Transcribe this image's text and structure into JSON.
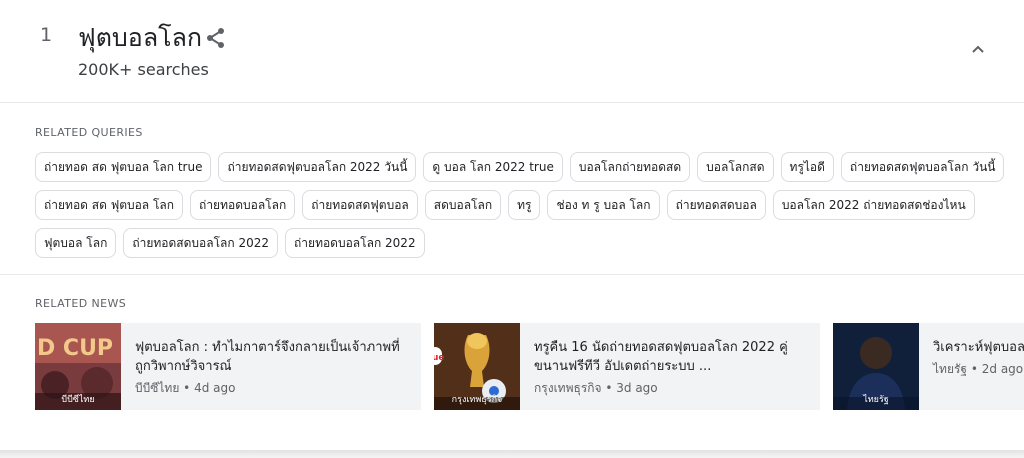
{
  "trend": {
    "rank": "1",
    "title": "ฟุตบอลโลก",
    "searches": "200K+ searches"
  },
  "related_queries": {
    "label": "RELATED QUERIES",
    "rows": [
      [
        "ถ่ายทอด สด ฟุตบอล โลก true",
        "ถ่ายทอดสดฟุตบอลโลก 2022 วันนี้",
        "ดู บอล โลก 2022 true",
        "บอลโลกถ่ายทอดสด",
        "บอลโลกสด",
        "ทรูไอดี",
        "ถ่ายทอดสดฟุตบอลโลก วันนี้"
      ],
      [
        "ถ่ายทอด สด ฟุตบอล โลก",
        "ถ่ายทอดบอลโลก",
        "ถ่ายทอดสดฟุตบอล",
        "สดบอลโลก",
        "ทรู",
        "ช่อง ท รู บอล โลก",
        "ถ่ายทอดสดบอล",
        "บอลโลก 2022 ถ่ายทอดสดช่องไหน"
      ],
      [
        "ฟุตบอล โลก",
        "ถ่ายทอดสดบอลโลก 2022",
        "ถ่ายทอดบอลโลก 2022"
      ]
    ]
  },
  "related_news": {
    "label": "RELATED NEWS",
    "items": [
      {
        "title": "ฟุตบอลโลก : ทำไมกาตาร์จึงกลายเป็นเจ้าภาพที่ถูกวิพากษ์วิจารณ์",
        "meta": "บีบีซีไทย • 4d ago",
        "thumb_source": "บีบีซีไทย"
      },
      {
        "title": "ทรูคืน 16 นัดถ่ายทอดสดฟุตบอลโลก 2022 คู่ขนานฟรีทีวี อัปเดตถ่ายระบบ ...",
        "meta": "กรุงเทพธุรกิจ • 3d ago",
        "thumb_source": "กรุงเทพธุรกิจ"
      },
      {
        "title": "วิเคราะห์ฟุตบอลโลก ออสเตรเลีย คาด",
        "meta": "ไทยรัฐ • 2d ago",
        "thumb_source": "ไทยรัฐ"
      }
    ]
  },
  "colors": {
    "chip_border": "#dadce0",
    "news_bg": "#f1f3f4",
    "secondary_text": "#5f6368"
  },
  "icons": [
    "share-icon",
    "chevron-up-icon"
  ]
}
